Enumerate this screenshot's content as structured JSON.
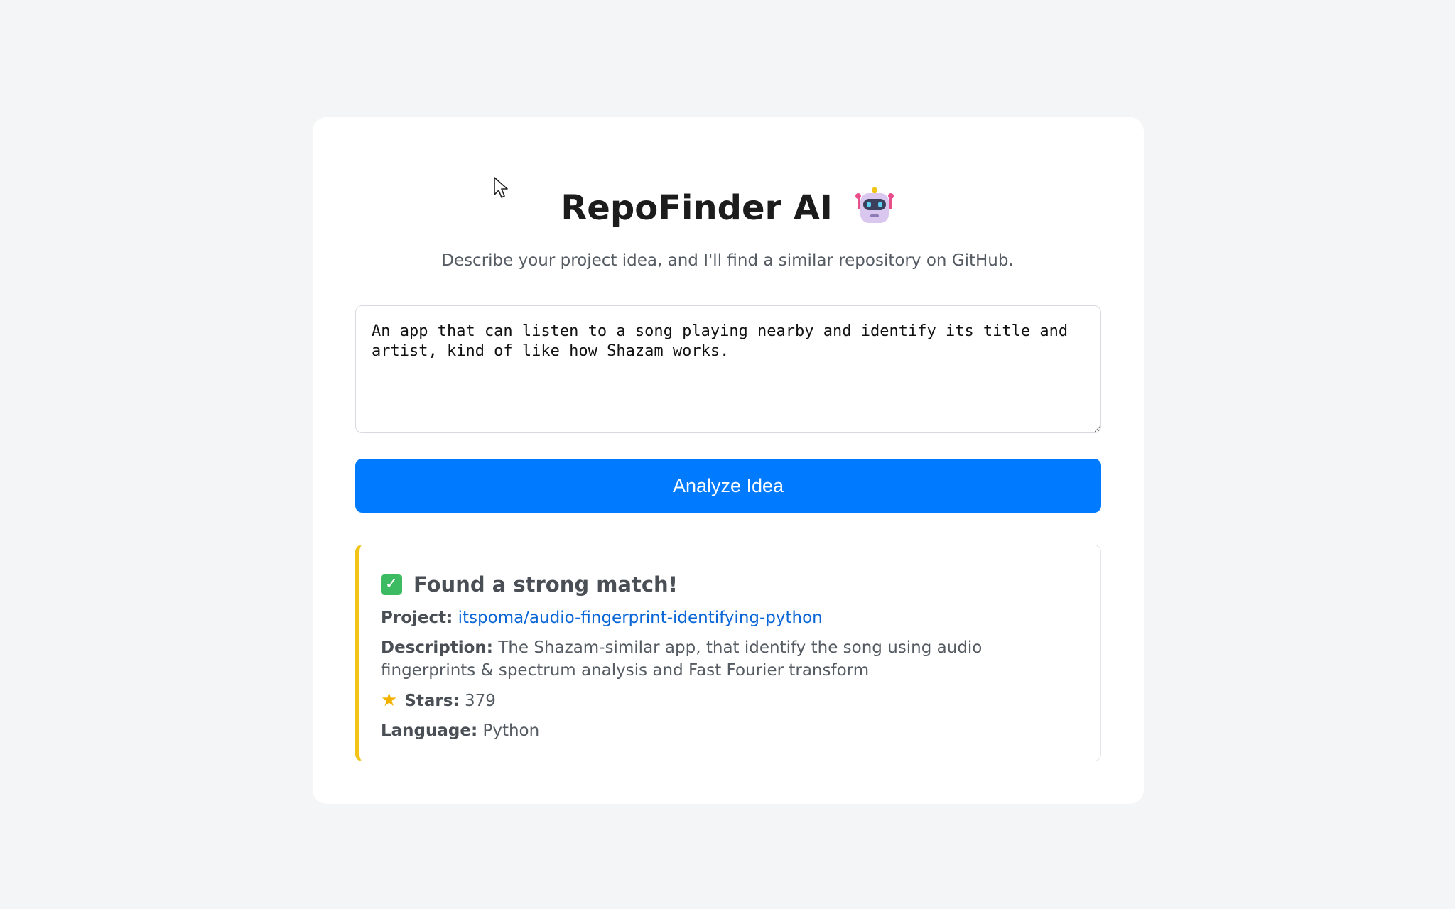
{
  "header": {
    "title": "RepoFinder AI",
    "subtitle": "Describe your project idea, and I'll find a similar repository on GitHub."
  },
  "input": {
    "value": "An app that can listen to a song playing nearby and identify its title and artist, kind of like how Shazam works."
  },
  "actions": {
    "analyze_label": "Analyze Idea"
  },
  "result": {
    "heading": "Found a strong match!",
    "project_label": "Project:",
    "project_value": "itspoma/audio-fingerprint-identifying-python",
    "description_label": "Description:",
    "description_value": "The Shazam-similar app, that identify the song using audio fingerprints & spectrum analysis and Fast Fourier transform",
    "stars_label": "Stars:",
    "stars_value": "379",
    "language_label": "Language:",
    "language_value": "Python"
  },
  "icons": {
    "title_icon": "robot-icon",
    "heading_icon": "check-icon",
    "stars_icon": "star-icon"
  },
  "colors": {
    "accent": "#007bff",
    "result_border": "#f2c418",
    "link": "#0a66d6",
    "success": "#3dbb63"
  }
}
